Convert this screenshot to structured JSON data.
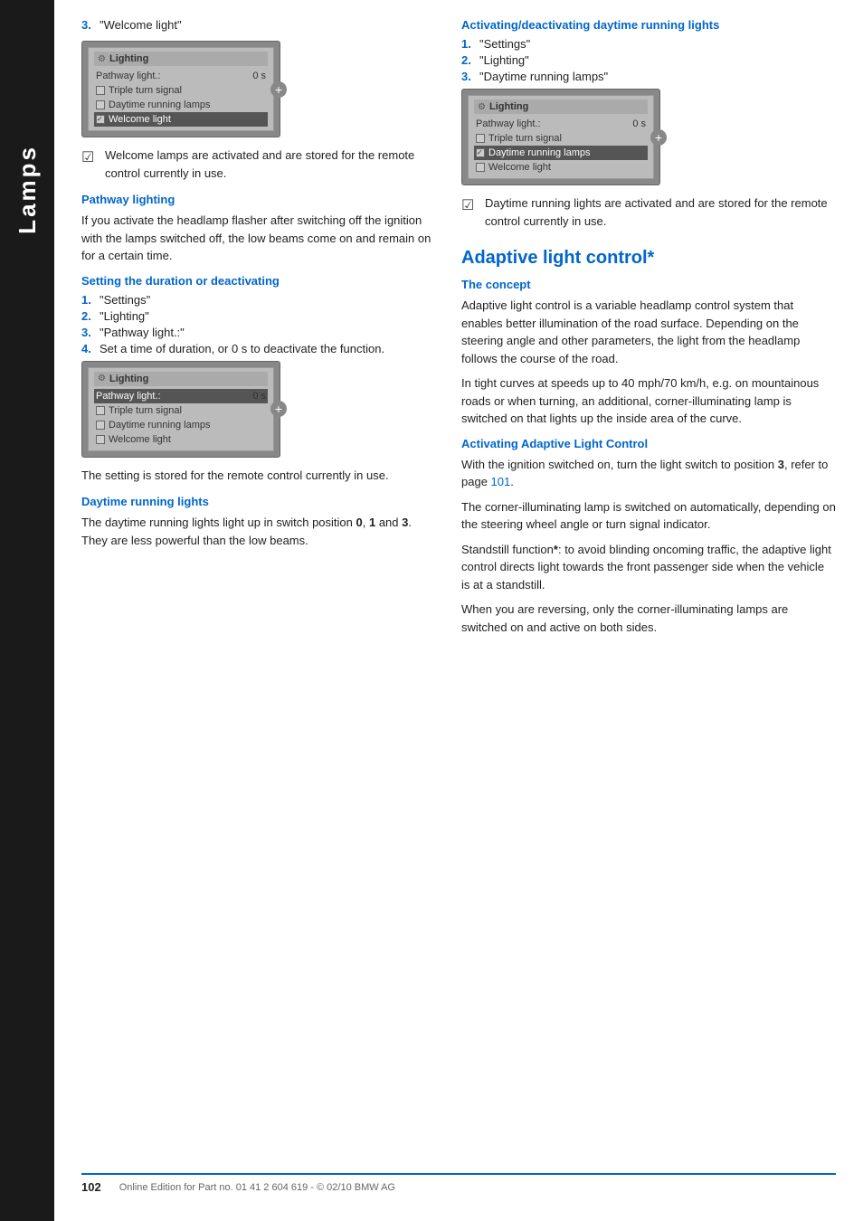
{
  "sidebar": {
    "label": "Lamps"
  },
  "left_col": {
    "welcome_step": {
      "num": "3.",
      "text": "\"Welcome light\""
    },
    "screen1": {
      "title": "Lighting",
      "row1_label": "Pathway light.:",
      "row1_val": "0 s",
      "row2_label": "Triple turn signal",
      "row3_label": "Daytime running lamps",
      "row4_label": "Welcome light",
      "row4_highlighted": true
    },
    "note1": "Welcome lamps are activated and are stored for the remote control currently in use.",
    "pathway_heading": "Pathway lighting",
    "pathway_body": "If you activate the headlamp flasher after switching off the ignition with the lamps switched off, the low beams come on and remain on for a certain time.",
    "setting_heading": "Setting the duration or deactivating",
    "steps": [
      {
        "num": "1.",
        "text": "\"Settings\""
      },
      {
        "num": "2.",
        "text": "\"Lighting\""
      },
      {
        "num": "3.",
        "text": "\"Pathway light.:\""
      },
      {
        "num": "4.",
        "text": "Set a time of duration, or 0 s to deactivate the function."
      }
    ],
    "screen2": {
      "title": "Lighting",
      "row1_label": "Pathway light.:",
      "row1_val": "0 s",
      "row1_highlighted": true,
      "row2_label": "Triple turn signal",
      "row3_label": "Daytime running lamps",
      "row4_label": "Welcome light"
    },
    "note2": "The setting is stored for the remote control currently in use.",
    "daytime_heading": "Daytime running lights",
    "daytime_body": "The daytime running lights light up in switch position 0, 1 and 3. They are less powerful than the low beams."
  },
  "right_col": {
    "activating_heading": "Activating/deactivating daytime running lights",
    "steps": [
      {
        "num": "1.",
        "text": "\"Settings\""
      },
      {
        "num": "2.",
        "text": "\"Lighting\""
      },
      {
        "num": "3.",
        "text": "\"Daytime running lamps\""
      }
    ],
    "screen3": {
      "title": "Lighting",
      "row1_label": "Pathway light.:",
      "row1_val": "0 s",
      "row2_label": "Triple turn signal",
      "row3_label": "Daytime running lamps",
      "row3_highlighted": true,
      "row4_label": "Welcome light"
    },
    "note3": "Daytime running lights are activated and are stored for the remote control currently in use.",
    "adaptive_heading": "Adaptive light control*",
    "concept_heading": "The concept",
    "concept_body1": "Adaptive light control is a variable headlamp control system that enables better illumination of the road surface. Depending on the steering angle and other parameters, the light from the headlamp follows the course of the road.",
    "concept_body2": "In tight curves at speeds up to 40 mph/70 km/h, e.g. on mountainous roads or when turning, an additional, corner-illuminating lamp is switched on that lights up the inside area of the curve.",
    "activating_adaptive_heading": "Activating Adaptive Light Control",
    "activating_adaptive_body1": "With the ignition switched on, turn the light switch to position 3, refer to page 101.",
    "activating_adaptive_body1_page": "101",
    "activating_adaptive_body2": "The corner-illuminating lamp is switched on automatically, depending on the steering wheel angle or turn signal indicator.",
    "activating_adaptive_body3": "Standstill function*: to avoid blinding oncoming traffic, the adaptive light control directs light towards the front passenger side when the vehicle is at a standstill.",
    "activating_adaptive_body4": "When you are reversing, only the corner-illuminating lamps are switched on and active on both sides."
  },
  "footer": {
    "page_num": "102",
    "text": "Online Edition for Part no. 01 41 2 604 619 - © 02/10 BMW AG"
  }
}
